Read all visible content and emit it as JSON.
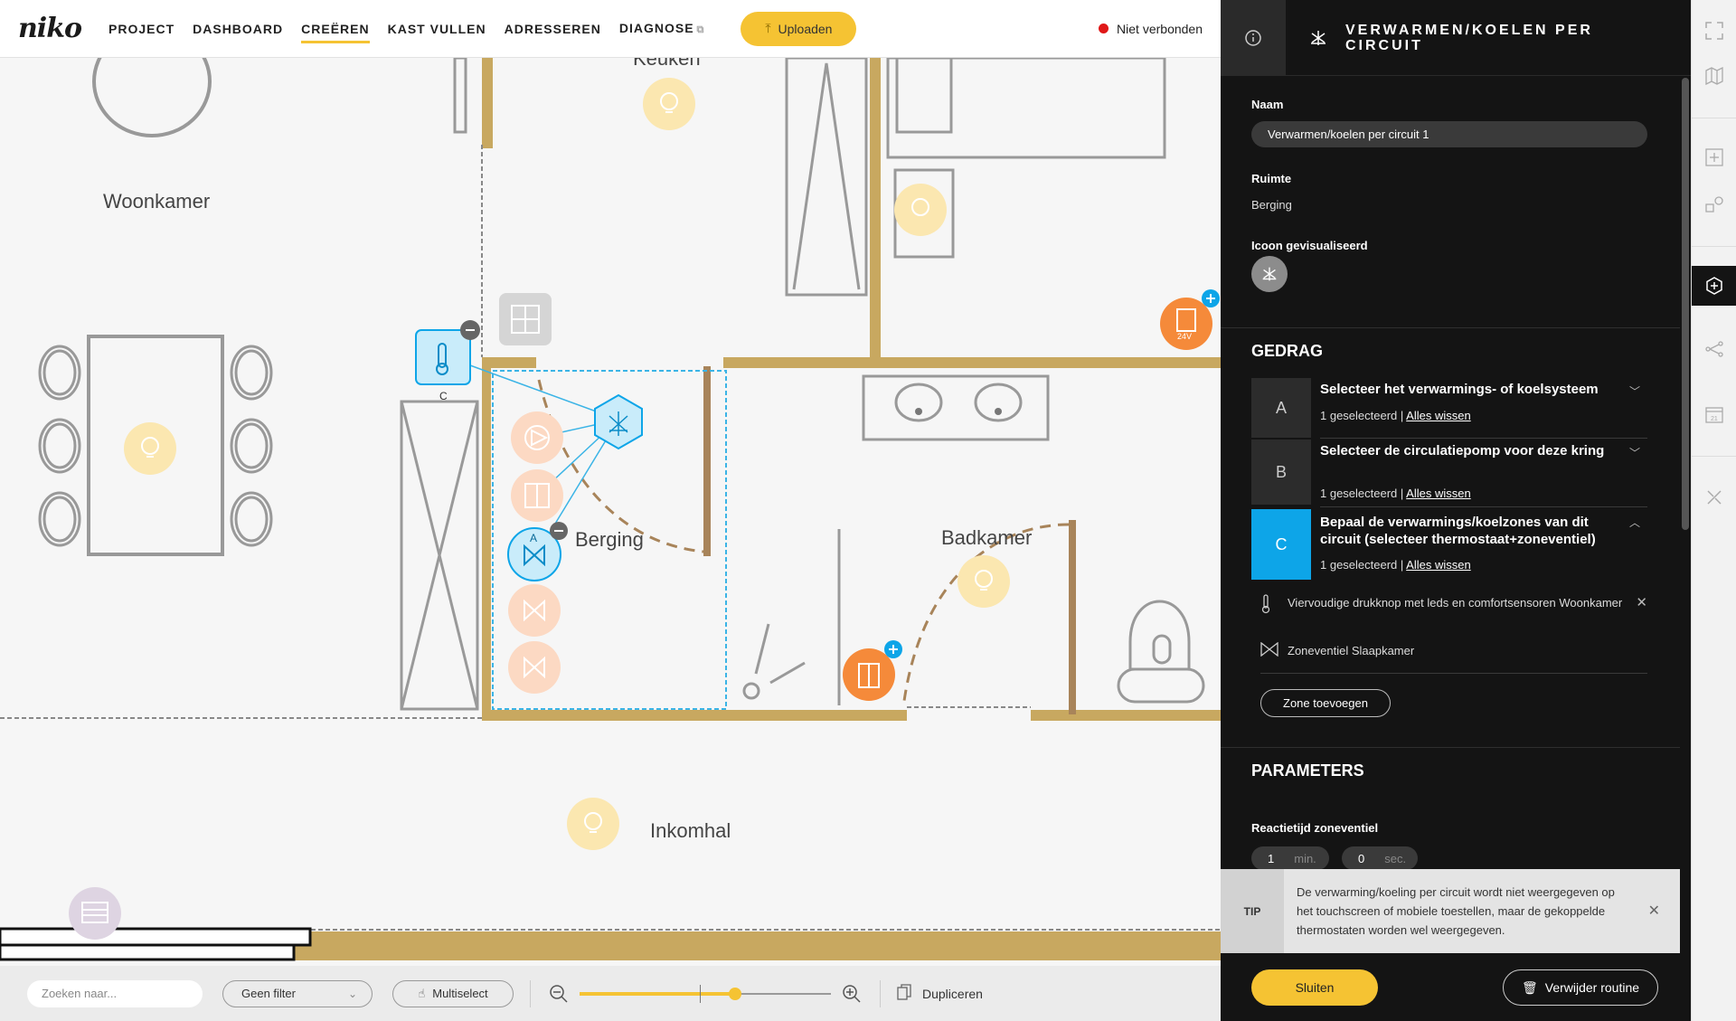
{
  "app": {
    "logo": "niko"
  },
  "nav": {
    "items": [
      {
        "label": "PROJECT"
      },
      {
        "label": "DASHBOARD"
      },
      {
        "label": "CREËREN"
      },
      {
        "label": "KAST VULLEN"
      },
      {
        "label": "ADRESSEREN"
      },
      {
        "label": "DIAGNOSE"
      }
    ],
    "active": "CREËREN",
    "upload_label": "Uploaden",
    "connection_status": "Niet verbonden",
    "connection_color": "#e01818"
  },
  "floorplan": {
    "rooms": [
      {
        "label": "Keuken"
      },
      {
        "label": "Woonkamer"
      },
      {
        "label": "Berging"
      },
      {
        "label": "Badkamer"
      },
      {
        "label": "Inkomhal"
      }
    ],
    "device_labels": {
      "thermostat_letter": "C",
      "valve_letter": "A",
      "power_label": "24V"
    }
  },
  "toolbar": {
    "search_placeholder": "Zoeken naar...",
    "filter_label": "Geen filter",
    "multiselect_label": "Multiselect",
    "zoom_level": 0.62,
    "duplicate_label": "Dupliceren"
  },
  "panel": {
    "title": "Verwarmen/koelen per circuit",
    "name_label": "Naam",
    "name_value": "Verwarmen/koelen per circuit 1",
    "room_label": "Ruimte",
    "room_value": "Berging",
    "icon_label": "Icoon gevisualiseerd",
    "behaviour_title": "GEDRAG",
    "steps": [
      {
        "letter": "A",
        "title": "Selecteer het verwarmings- of koelsysteem",
        "status": "1 geselecteerd",
        "clear": "Alles wissen",
        "active": false
      },
      {
        "letter": "B",
        "title": "Selecteer de circulatiepomp voor deze kring",
        "status": "1 geselecteerd",
        "clear": "Alles wissen",
        "active": false
      },
      {
        "letter": "C",
        "title": "Bepaal de verwarmings/koelzones van dit circuit (selecteer thermostaat+zoneventiel)",
        "status": "1 geselecteerd",
        "clear": "Alles wissen",
        "active": true
      }
    ],
    "selected_items": [
      {
        "label": "Viervoudige drukknop met leds en comfortsensoren Woonkamer",
        "icon": "thermometer-icon"
      },
      {
        "label": "Zoneventiel Slaapkamer",
        "icon": "valve-icon"
      }
    ],
    "add_zone_label": "Zone toevoegen",
    "parameters_title": "PARAMETERS",
    "reaction_label": "Reactietijd zoneventiel",
    "reaction_min_value": "1",
    "reaction_min_unit": "min.",
    "reaction_sec_value": "0",
    "reaction_sec_unit": "sec.",
    "tip_label": "TIP",
    "tip_text": "De verwarming/koeling per circuit wordt niet weergegeven op het touchscreen of mobiele toestellen, maar de gekoppelde thermostaten worden wel weergegeven.",
    "close_label": "Sluiten",
    "delete_label": "Verwijder routine"
  },
  "colors": {
    "accent": "#f5c333",
    "selected_blue": "#0da5e8",
    "device_orange": "#f58a3a",
    "wall_gold": "#c8a860"
  }
}
